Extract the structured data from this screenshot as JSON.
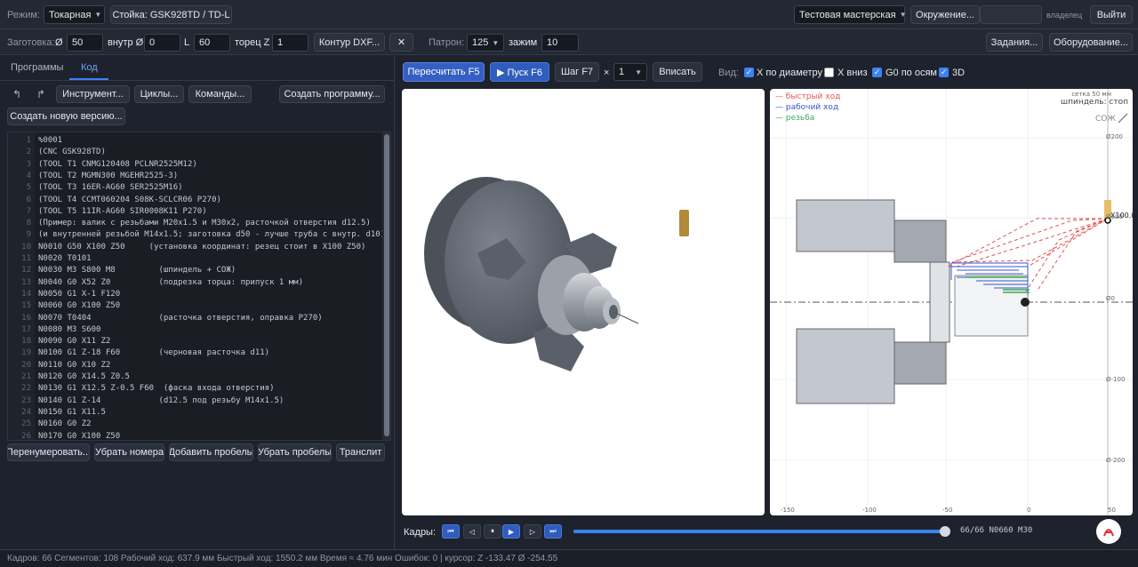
{
  "top": {
    "mode_label": "Режим:",
    "mode_value": "Токарная",
    "machine_button": "Стойка: GSK928TD / TD-L",
    "workshop_value": "Тестовая мастерская",
    "env_button": "Окружение...",
    "owner_badge": "владелец",
    "exit_button": "Выйти"
  },
  "blank": {
    "label": "Заготовка:",
    "dia_symbol": "Ø",
    "dia_value": "50",
    "inner_label": "внутр Ø",
    "inner_value": "0",
    "len_label": "L",
    "len_value": "60",
    "face_label": "торец Z",
    "face_value": "1",
    "contour_button": "Контур DXF...",
    "close_button": "✕",
    "chuck_label": "Патрон:",
    "chuck_value": "125",
    "clamp_label": "зажим",
    "clamp_value": "10",
    "tasks_button": "Задания...",
    "equipment_button": "Оборудование..."
  },
  "left": {
    "tab_programs": "Программы",
    "tab_code": "Код",
    "undo": "↰",
    "redo": "↱",
    "tools_button": "Инструмент...",
    "cycles_button": "Циклы...",
    "commands_button": "Команды...",
    "create_program_button": "Создать программу...",
    "new_version_button": "Создать новую версию...",
    "renumber_button": "Перенумеровать...",
    "remove_numbers_button": "Убрать номера",
    "add_spaces_button": "Добавить пробелы",
    "remove_spaces_button": "Убрать пробелы",
    "translit_button": "Транслит"
  },
  "code_lines": [
    {
      "n": "1",
      "t": "%0001"
    },
    {
      "n": "2",
      "t": "(CNC GSK928TD)"
    },
    {
      "n": "3",
      "t": "(TOOL T1 CNMG120408 PCLNR2525M12)"
    },
    {
      "n": "4",
      "t": "(TOOL T2 MGMN300 MGEHR2525-3)"
    },
    {
      "n": "5",
      "t": "(TOOL T3 16ER-AG60 SER2525M16)"
    },
    {
      "n": "6",
      "t": "(TOOL T4 CCMT060204 S08K-SCLCR06 P270)"
    },
    {
      "n": "7",
      "t": "(TOOL T5 11IR-AG60 SIR0008K11 P270)"
    },
    {
      "n": "8",
      "t": "(Пример: валик с резьбами M20x1.5 и M30x2, расточкой отверстия d12.5)"
    },
    {
      "n": "9",
      "t": "(и внутренней резьбой M14x1.5; заготовка d50 - лучше труба с внутр. d10)"
    },
    {
      "n": "10",
      "t": "N0010 G50 X100 Z50     (установка координат: резец стоит в X100 Z50)"
    },
    {
      "n": "11",
      "t": "N0020 T0101"
    },
    {
      "n": "12",
      "t": "N0030 M3 S800 M8         (шпиндель + СОЖ)"
    },
    {
      "n": "13",
      "t": "N0040 G0 X52 Z0          (подрезка торца: припуск 1 мм)"
    },
    {
      "n": "14",
      "t": "N0050 G1 X-1 F120"
    },
    {
      "n": "15",
      "t": "N0060 G0 X100 Z50"
    },
    {
      "n": "16",
      "t": "N0070 T0404              (расточка отверстия, оправка P270)"
    },
    {
      "n": "17",
      "t": "N0080 M3 S600"
    },
    {
      "n": "18",
      "t": "N0090 G0 X11 Z2"
    },
    {
      "n": "19",
      "t": "N0100 G1 Z-18 F60        (черновая расточка d11)"
    },
    {
      "n": "20",
      "t": "N0110 G0 X10 Z2"
    },
    {
      "n": "21",
      "t": "N0120 G0 X14.5 Z0.5"
    },
    {
      "n": "22",
      "t": "N0130 G1 X12.5 Z-0.5 F60  (фаска входа отверстия)"
    },
    {
      "n": "23",
      "t": "N0140 G1 Z-14            (d12.5 под резьбу M14x1.5)"
    },
    {
      "n": "24",
      "t": "N0150 G1 X11.5"
    },
    {
      "n": "25",
      "t": "N0160 G0 Z2"
    },
    {
      "n": "26",
      "t": "N0170 G0 X100 Z50"
    }
  ],
  "sim": {
    "recalc_button": "Пересчитать F5",
    "run_button": "▶ Пуск F6",
    "step_button": "Шаг F7",
    "times": "×",
    "step_value": "1",
    "fit_button": "Вписать",
    "view_label": "Вид:",
    "xdia_label": "X по диаметру",
    "xdown_label": "X вниз",
    "g0_label": "G0 по осям",
    "d3_label": "3D"
  },
  "plot2d": {
    "legend_rapid": "— быстрый ход",
    "legend_work": "— рабочий ход",
    "legend_thread": "— резьба",
    "grid_note": "сетка 50 мм",
    "spindle_note": "шпиндель: стоп",
    "coolant_note": "СОЖ",
    "x_ticks": [
      "-150",
      "-100",
      "-50",
      "0",
      "50"
    ],
    "y_ticks": [
      "Ø200",
      "Ø100",
      "Ø0",
      "Ø-100",
      "Ø-200"
    ],
    "tool_label": "X100.0"
  },
  "frames": {
    "label": "Кадры:",
    "readout": "66/66 N0660 M30",
    "progress": 1.0
  },
  "status": "Кадров: 66 Сегментов: 108 Рабочий ход: 637.9 мм Быстрый ход: 1550.2 мм Время ≈ 4.76 мин Ошибок: 0 | курсор: Z -133.47 Ø -254.55",
  "colors": {
    "rapid": "#e05555",
    "work": "#3a55d0",
    "thread": "#3ca85a",
    "accent": "#3b82f6"
  }
}
